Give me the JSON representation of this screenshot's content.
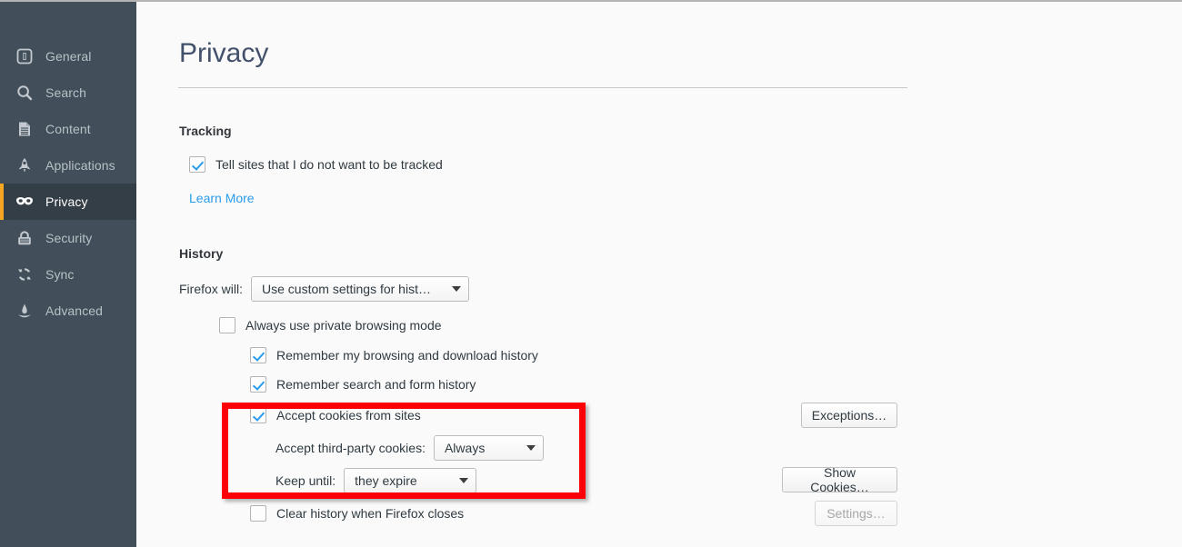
{
  "sidebar": {
    "items": [
      {
        "id": "general",
        "label": "General",
        "icon": "general-icon",
        "active": false
      },
      {
        "id": "search",
        "label": "Search",
        "icon": "search-icon",
        "active": false
      },
      {
        "id": "content",
        "label": "Content",
        "icon": "content-icon",
        "active": false
      },
      {
        "id": "applications",
        "label": "Applications",
        "icon": "rocket-icon",
        "active": false
      },
      {
        "id": "privacy",
        "label": "Privacy",
        "icon": "mask-icon",
        "active": true
      },
      {
        "id": "security",
        "label": "Security",
        "icon": "lock-icon",
        "active": false
      },
      {
        "id": "sync",
        "label": "Sync",
        "icon": "sync-icon",
        "active": false
      },
      {
        "id": "advanced",
        "label": "Advanced",
        "icon": "gear-advanced-icon",
        "active": false
      }
    ]
  },
  "main": {
    "title": "Privacy",
    "tracking": {
      "heading": "Tracking",
      "do_not_track_label": "Tell sites that I do not want to be tracked",
      "do_not_track_checked": true,
      "learn_more_label": "Learn More"
    },
    "history": {
      "heading": "History",
      "firefox_will_label": "Firefox will:",
      "firefox_will_value": "Use custom settings for hist…",
      "private_browsing_label": "Always use private browsing mode",
      "private_browsing_checked": false,
      "remember_history_label": "Remember my browsing and download history",
      "remember_history_checked": true,
      "remember_forms_label": "Remember search and form history",
      "remember_forms_checked": true,
      "accept_cookies_label": "Accept cookies from sites",
      "accept_cookies_checked": true,
      "third_party_label": "Accept third-party cookies:",
      "third_party_value": "Always",
      "keep_until_label": "Keep until:",
      "keep_until_value": "they expire",
      "clear_history_label": "Clear history when Firefox closes",
      "clear_history_checked": false,
      "exceptions_button": "Exceptions…",
      "show_cookies_button": "Show Cookies…",
      "settings_button": "Settings…",
      "settings_button_disabled": true
    }
  },
  "annotation": {
    "color": "#fb0007",
    "target": "cookie-settings-group"
  },
  "colors": {
    "sidebar_bg": "#424f5a",
    "sidebar_active_bg": "#343e47",
    "accent_orange": "#f5a623",
    "link_blue": "#2a9ced",
    "checkbox_blue": "#2a9ced",
    "title_text": "#42506b",
    "content_bg": "#fafafa"
  }
}
